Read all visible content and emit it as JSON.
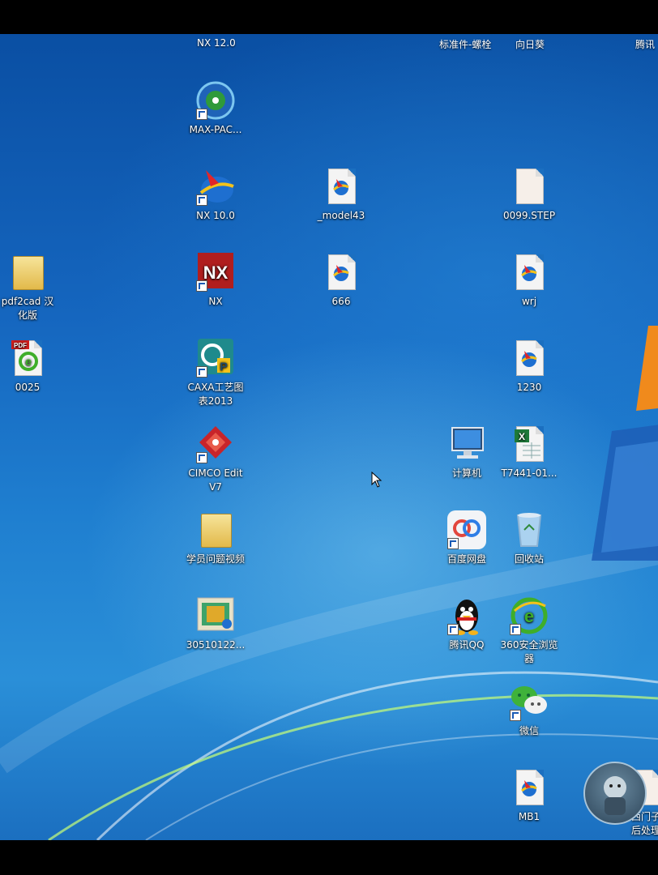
{
  "top_labels": [
    {
      "text": "NX 12.0"
    },
    {
      "text": "标准件-螺栓"
    },
    {
      "text": "向日葵"
    },
    {
      "text": "腾讯"
    }
  ],
  "icons": {
    "maxpac": {
      "label": "MAX-PAC...",
      "icon": "maxpac-icon"
    },
    "nx10": {
      "label": "NX 10.0",
      "icon": "nx-globe-icon"
    },
    "model43": {
      "label": "_model43",
      "icon": "nx-part-file-icon"
    },
    "step0099": {
      "label": "0099.STEP",
      "icon": "blank-file-icon"
    },
    "pdf2cad": {
      "label": "pdf2cad 汉\n化版",
      "icon": "folder-icon"
    },
    "nx": {
      "label": "NX",
      "icon": "nx-logo-icon"
    },
    "f666": {
      "label": "666",
      "icon": "nx-part-file-icon"
    },
    "wrj": {
      "label": "wrj",
      "icon": "nx-part-file-icon"
    },
    "f0025": {
      "label": "0025",
      "icon": "pdf-ie-icon"
    },
    "caxa": {
      "label": "CAXA工艺图\n表2013",
      "icon": "caxa-icon"
    },
    "f1230": {
      "label": "1230",
      "icon": "nx-part-file-icon"
    },
    "cimco": {
      "label": "CIMCO Edit\nV7",
      "icon": "cimco-icon"
    },
    "computer": {
      "label": "计算机",
      "icon": "computer-icon"
    },
    "t7441": {
      "label": "T7441-01...",
      "icon": "excel-file-icon"
    },
    "xueyuan": {
      "label": "学员问题视频",
      "icon": "folder-icon"
    },
    "baidu": {
      "label": "百度网盘",
      "icon": "baidu-netdisk-icon"
    },
    "recycle": {
      "label": "回收站",
      "icon": "recycle-bin-icon"
    },
    "f30510122": {
      "label": "30510122...",
      "icon": "image-file-icon"
    },
    "qq": {
      "label": "腾讯QQ",
      "icon": "qq-penguin-icon"
    },
    "browser360": {
      "label": "360安全浏览\n器",
      "icon": "360-browser-icon"
    },
    "wechat": {
      "label": "微信",
      "icon": "wechat-icon"
    },
    "mb1": {
      "label": "MB1",
      "icon": "nx-part-file-icon"
    },
    "siemens": {
      "label": "西门子\n后处理",
      "icon": "blank-file-icon"
    }
  },
  "colors": {
    "desktop_top": "#0a4fa3",
    "desktop_bottom": "#2a8fd8"
  }
}
